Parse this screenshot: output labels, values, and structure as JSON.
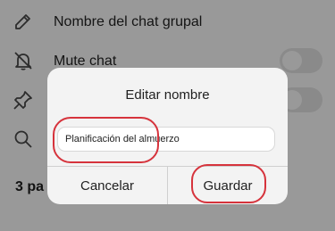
{
  "settings": {
    "group_name_label": "Nombre del chat grupal",
    "mute_label": "Mute chat",
    "participants_label": "3 pa"
  },
  "dialog": {
    "title": "Editar nombre",
    "input_value": "Planificación del almuerzo",
    "cancel_label": "Cancelar",
    "save_label": "Guardar"
  },
  "colors": {
    "highlight": "#d6333c",
    "overlay": "rgba(0,0,0,0.40)",
    "dialog_bg": "#f3f3f3"
  },
  "icons": [
    "pencil-icon",
    "bell-off-icon",
    "pin-icon",
    "search-icon"
  ]
}
